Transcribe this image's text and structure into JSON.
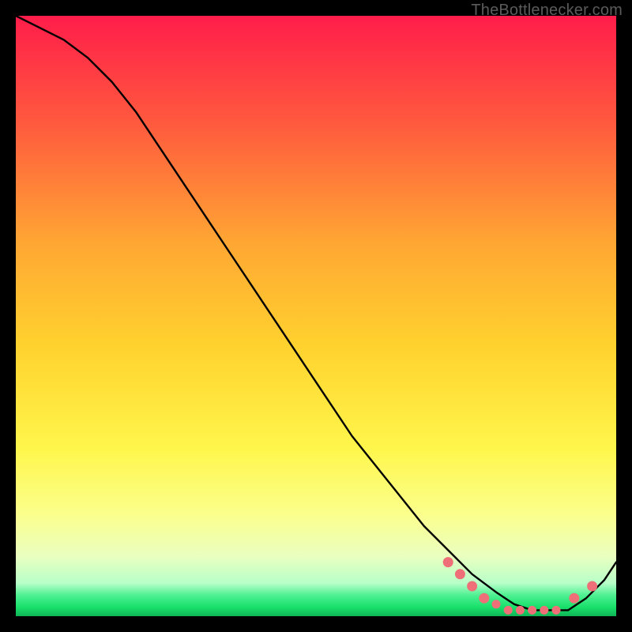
{
  "watermark": "TheBottlenecker.com",
  "colors": {
    "bg_black": "#000000",
    "grad_top": "#ff1d4a",
    "grad_mid_upper": "#ff7a35",
    "grad_mid": "#ffd22e",
    "grad_mid_lower": "#fff64b",
    "grad_pale": "#f8ffb0",
    "grad_green": "#18e06a",
    "curve": "#000000",
    "dots": "#ef6f78"
  },
  "chart_data": {
    "type": "line",
    "title": "",
    "xlabel": "",
    "ylabel": "",
    "xlim": [
      0,
      100
    ],
    "ylim": [
      0,
      100
    ],
    "series": [
      {
        "name": "bottleneck-curve",
        "x": [
          0,
          4,
          8,
          12,
          16,
          20,
          24,
          28,
          32,
          36,
          40,
          44,
          48,
          52,
          56,
          60,
          64,
          68,
          72,
          76,
          80,
          83,
          86,
          89,
          92,
          95,
          98,
          100
        ],
        "y": [
          100,
          98,
          96,
          93,
          89,
          84,
          78,
          72,
          66,
          60,
          54,
          48,
          42,
          36,
          30,
          25,
          20,
          15,
          11,
          7,
          4,
          2,
          1,
          1,
          1,
          3,
          6,
          9
        ]
      }
    ],
    "optimal_points": {
      "name": "optimal-range-dots",
      "x": [
        72,
        74,
        76,
        78,
        80,
        82,
        84,
        86,
        88,
        90,
        93,
        96
      ],
      "y": [
        9,
        7,
        5,
        3,
        2,
        1,
        1,
        1,
        1,
        1,
        3,
        5
      ]
    }
  }
}
